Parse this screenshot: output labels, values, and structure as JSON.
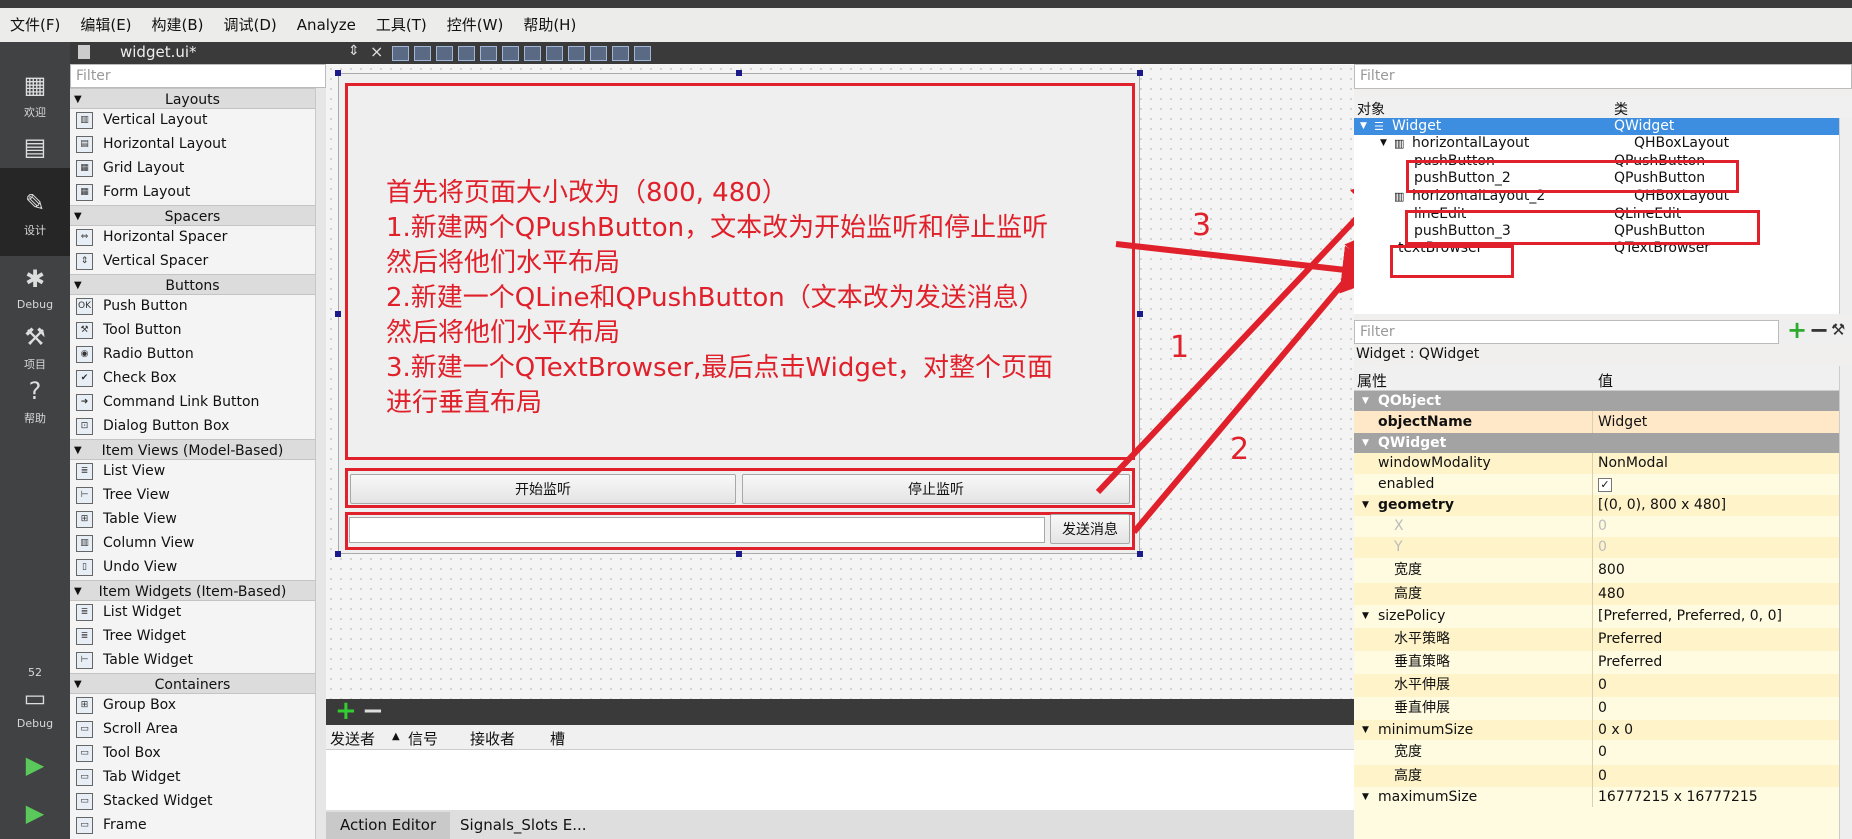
{
  "menu": [
    "文件(F)",
    "编辑(E)",
    "构建(B)",
    "调试(D)",
    "Analyze",
    "工具(T)",
    "控件(W)",
    "帮助(H)"
  ],
  "modes": [
    {
      "label": "欢迎",
      "icon": "grid-icon"
    },
    {
      "label": "编辑",
      "icon": "edit-icon"
    },
    {
      "label": "设计",
      "icon": "pencil-icon"
    },
    {
      "label": "Debug",
      "icon": "bug-icon"
    },
    {
      "label": "项目",
      "icon": "wrench-icon"
    },
    {
      "label": "帮助",
      "icon": "help-icon"
    }
  ],
  "kit": {
    "number": "52",
    "label": "Debug"
  },
  "editor_toolbar": {
    "file": "widget.ui*"
  },
  "widgetbox": {
    "filter_placeholder": "Filter",
    "rows": [
      {
        "type": "cat",
        "label": "Layouts"
      },
      {
        "type": "item",
        "label": "Vertical Layout"
      },
      {
        "type": "item",
        "label": "Horizontal Layout"
      },
      {
        "type": "item",
        "label": "Grid Layout"
      },
      {
        "type": "item",
        "label": "Form Layout"
      },
      {
        "type": "cat",
        "label": "Spacers"
      },
      {
        "type": "item",
        "label": "Horizontal Spacer"
      },
      {
        "type": "item",
        "label": "Vertical Spacer"
      },
      {
        "type": "cat",
        "label": "Buttons"
      },
      {
        "type": "item",
        "label": "Push Button"
      },
      {
        "type": "item",
        "label": "Tool Button"
      },
      {
        "type": "item",
        "label": "Radio Button"
      },
      {
        "type": "item",
        "label": "Check Box"
      },
      {
        "type": "item",
        "label": "Command Link Button"
      },
      {
        "type": "item",
        "label": "Dialog Button Box"
      },
      {
        "type": "cat",
        "label": "Item Views (Model-Based)"
      },
      {
        "type": "item",
        "label": "List View"
      },
      {
        "type": "item",
        "label": "Tree View"
      },
      {
        "type": "item",
        "label": "Table View"
      },
      {
        "type": "item",
        "label": "Column View"
      },
      {
        "type": "item",
        "label": "Undo View"
      },
      {
        "type": "cat",
        "label": "Item Widgets (Item-Based)"
      },
      {
        "type": "item",
        "label": "List Widget"
      },
      {
        "type": "item",
        "label": "Tree Widget"
      },
      {
        "type": "item",
        "label": "Table Widget"
      },
      {
        "type": "cat",
        "label": "Containers"
      },
      {
        "type": "item",
        "label": "Group Box"
      },
      {
        "type": "item",
        "label": "Scroll Area"
      },
      {
        "type": "item",
        "label": "Tool Box"
      },
      {
        "type": "item",
        "label": "Tab Widget"
      },
      {
        "type": "item",
        "label": "Stacked Widget"
      },
      {
        "type": "item",
        "label": "Frame"
      }
    ]
  },
  "form": {
    "annotation": "首先将页面大小改为（800, 480）\n1.新建两个QPushButton，文本改为开始监听和停止监听\n然后将他们水平布局\n2.新建一个QLine和QPushButton（文本改为发送消息）\n然后将他们水平布局\n3.新建一个QTextBrowser,最后点击Widget，对整个页面\n进行垂直布局",
    "btn_start": "开始监听",
    "btn_stop": "停止监听",
    "btn_send": "发送消息",
    "marker_1": "1",
    "marker_2": "2",
    "marker_3": "3"
  },
  "signals": {
    "columns": [
      "发送者",
      "信号",
      "接收者",
      "槽"
    ],
    "tabs": [
      "Action Editor",
      "Signals_Slots E..."
    ]
  },
  "object_inspector": {
    "filter_placeholder": "Filter",
    "col_object": "对象",
    "col_class": "类",
    "rows": [
      {
        "object": "Widget",
        "class": "QWidget"
      },
      {
        "object": "horizontalLayout",
        "class": "QHBoxLayout"
      },
      {
        "object": "pushButton",
        "class": "QPushButton"
      },
      {
        "object": "pushButton_2",
        "class": "QPushButton"
      },
      {
        "object": "horizontalLayout_2",
        "class": "QHBoxLayout"
      },
      {
        "object": "lineEdit",
        "class": "QLineEdit"
      },
      {
        "object": "pushButton_3",
        "class": "QPushButton"
      },
      {
        "object": "textBrowser",
        "class": "QTextBrowser"
      }
    ]
  },
  "property_editor": {
    "filter_placeholder": "Filter",
    "title": "Widget : QWidget",
    "col_prop": "属性",
    "col_value": "值",
    "rows": [
      {
        "key": "QObject",
        "value": "",
        "kind": "grp"
      },
      {
        "key": "objectName",
        "value": "Widget",
        "kind": "hl"
      },
      {
        "key": "QWidget",
        "value": "",
        "kind": "grp"
      },
      {
        "key": "windowModality",
        "value": "NonModal",
        "kind": "n"
      },
      {
        "key": "enabled",
        "value": "✓",
        "kind": "n"
      },
      {
        "key": "geometry",
        "value": "[(0, 0), 800 x 480]",
        "kind": "n"
      },
      {
        "key": "X",
        "value": "0",
        "kind": "sub"
      },
      {
        "key": "Y",
        "value": "0",
        "kind": "sub"
      },
      {
        "key": "宽度",
        "value": "800",
        "kind": "sub"
      },
      {
        "key": "高度",
        "value": "480",
        "kind": "sub"
      },
      {
        "key": "sizePolicy",
        "value": "[Preferred, Preferred, 0, 0]",
        "kind": "n"
      },
      {
        "key": "水平策略",
        "value": "Preferred",
        "kind": "sub"
      },
      {
        "key": "垂直策略",
        "value": "Preferred",
        "kind": "sub"
      },
      {
        "key": "水平伸展",
        "value": "0",
        "kind": "sub"
      },
      {
        "key": "垂直伸展",
        "value": "0",
        "kind": "sub"
      },
      {
        "key": "minimumSize",
        "value": "0 x 0",
        "kind": "n"
      },
      {
        "key": "宽度",
        "value": "0",
        "kind": "sub"
      },
      {
        "key": "高度",
        "value": "0",
        "kind": "sub"
      },
      {
        "key": "maximumSize",
        "value": "16777215 x 16777215",
        "kind": "n"
      }
    ]
  },
  "colors": {
    "annotation_red": "#e0202a",
    "selection_blue": "#3d8ee0",
    "prop_yellow": "#fffbe0"
  }
}
